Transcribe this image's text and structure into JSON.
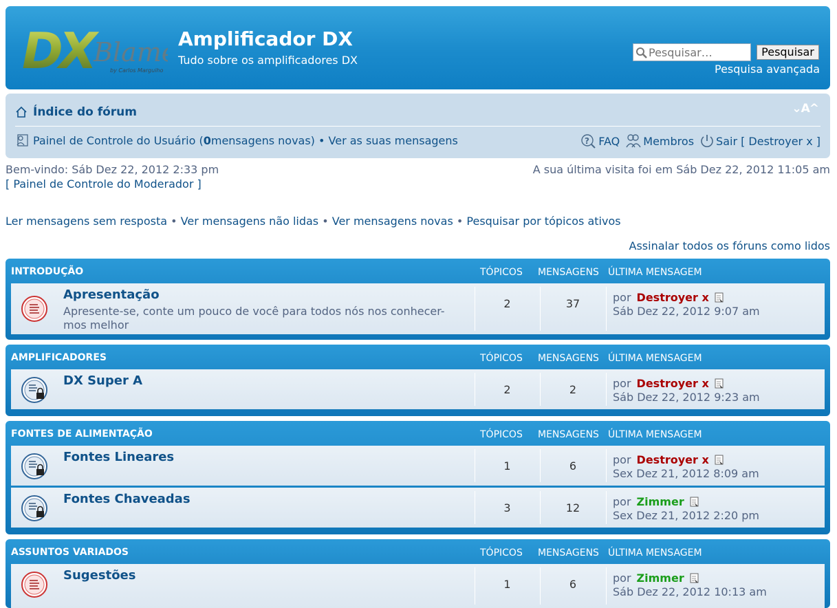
{
  "header": {
    "logo_text": "DX Blame",
    "logo_byline": "by Carlos Marguiho",
    "site_title": "Amplificador DX",
    "site_description": "Tudo sobre os amplificadores DX",
    "search_placeholder": "Pesquisar…",
    "search_button": "Pesquisar",
    "advanced_search": "Pesquisa avançada"
  },
  "navbar": {
    "index_label": "Índice do fórum",
    "font_resize": "⌄A^",
    "ucp_label": "Painel de Controle do Usuário (",
    "new_messages_count": "0",
    "new_messages_suffix": " mensagens novas)",
    "sep": " • ",
    "view_posts": "Ver as suas mensagens",
    "faq": "FAQ",
    "members": "Membros",
    "logout": "Sair [ Destroyer x ]"
  },
  "welcome": "Bem-vindo: Sáb Dez 22, 2012 2:33 pm",
  "last_visit": "A sua última visita foi em Sáb Dez 22, 2012 11:05 am",
  "mod_panel": "[ Painel de Controle do Moderador ]",
  "search_links": [
    "Ler mensagens sem resposta",
    "Ver mensagens não lidas",
    "Ver mensagens novas",
    "Pesquisar por tópicos ativos"
  ],
  "search_links_sep": " • ",
  "mark_read": "Assinalar todos os fóruns como lidos",
  "columns": {
    "topics": "TÓPICOS",
    "posts": "MENSAGENS",
    "last_post": "ÚLTIMA MENSAGEM"
  },
  "categories": [
    {
      "title": "INTRODUÇÃO",
      "forums": [
        {
          "name": "Apresentação",
          "description": "Apresente-se, conte um pouco de você para todos nós nos conhecer-mos melhor",
          "topics": "2",
          "posts": "37",
          "by": "por",
          "author": "Destroyer x",
          "author_color": "#aa0000",
          "date": "Sáb Dez 22, 2012 9:07 am",
          "icon": "forum-unread-icon"
        }
      ]
    },
    {
      "title": "AMPLIFICADORES",
      "forums": [
        {
          "name": "DX Super A",
          "description": "",
          "topics": "2",
          "posts": "2",
          "by": "por",
          "author": "Destroyer x",
          "author_color": "#aa0000",
          "date": "Sáb Dez 22, 2012 9:23 am",
          "icon": "forum-locked-icon"
        }
      ]
    },
    {
      "title": "FONTES DE ALIMENTAÇÃO",
      "forums": [
        {
          "name": "Fontes Lineares",
          "description": "",
          "topics": "1",
          "posts": "6",
          "by": "por",
          "author": "Destroyer x",
          "author_color": "#aa0000",
          "date": "Sex Dez 21, 2012 8:09 am",
          "icon": "forum-locked-icon"
        },
        {
          "name": "Fontes Chaveadas",
          "description": "",
          "topics": "3",
          "posts": "12",
          "by": "por",
          "author": "Zimmer",
          "author_color": "#1b9e1b",
          "date": "Sex Dez 21, 2012 2:20 pm",
          "icon": "forum-locked-icon"
        }
      ]
    },
    {
      "title": "ASSUNTOS VARIADOS",
      "forums": [
        {
          "name": "Sugestões",
          "description": "",
          "topics": "1",
          "posts": "6",
          "by": "por",
          "author": "Zimmer",
          "author_color": "#1b9e1b",
          "date": "Sáb Dez 22, 2012 10:13 am",
          "icon": "forum-unread-icon"
        }
      ]
    }
  ]
}
